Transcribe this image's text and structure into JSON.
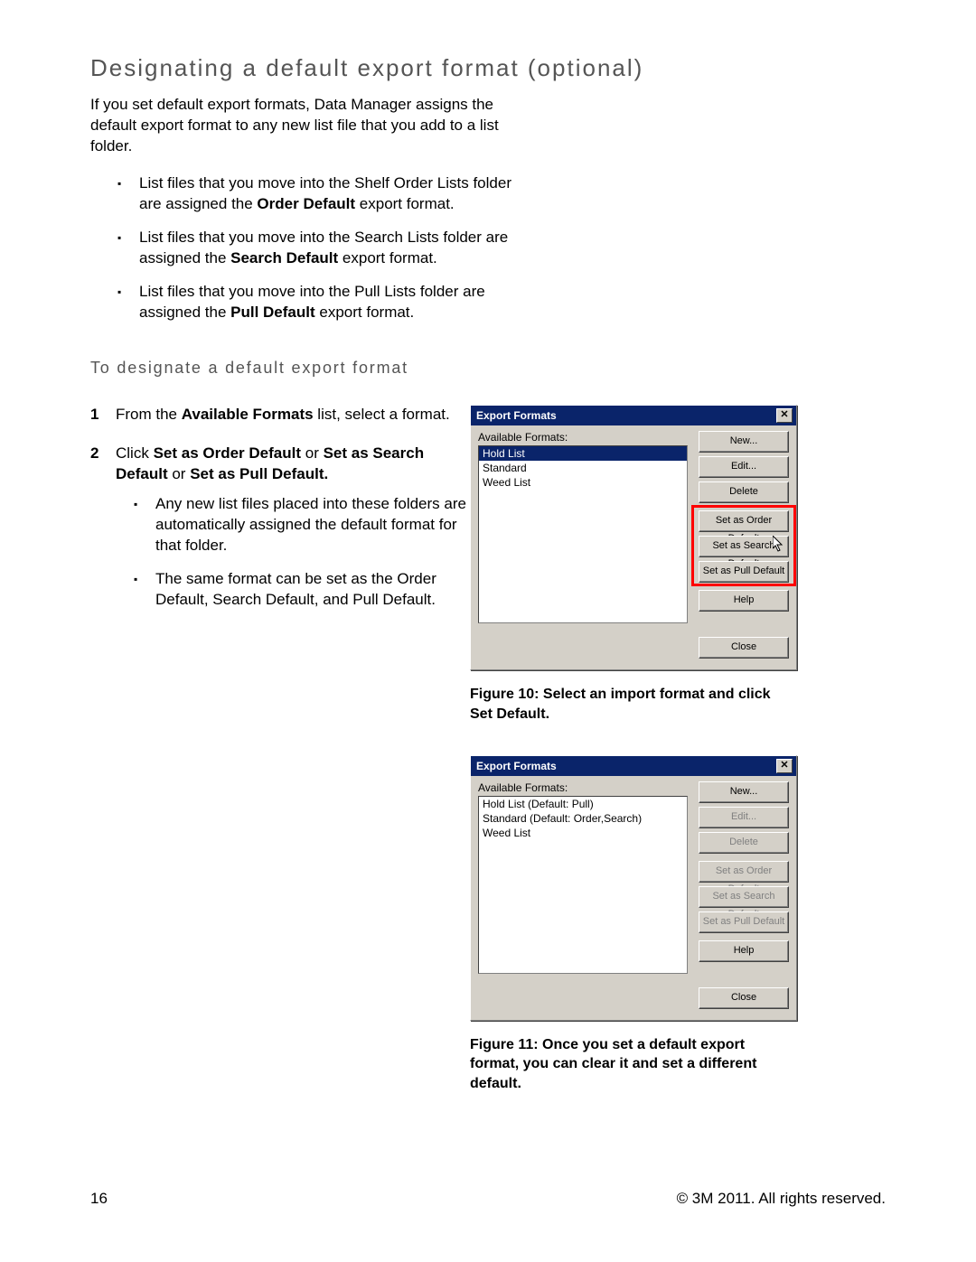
{
  "heading": "Designating a default export format (optional)",
  "intro": "If you set default export formats, Data Manager assigns the default export format to any new list file that you add to a list folder.",
  "bullets": [
    {
      "pre": "List files that you move into the Shelf Order Lists folder are assigned the ",
      "bold": "Order Default",
      "post": " export format."
    },
    {
      "pre": "List files that you move into the Search Lists folder are assigned the ",
      "bold": "Search Default",
      "post": " export format."
    },
    {
      "pre": "List files that you move into the Pull Lists folder are assigned the ",
      "bold": "Pull Default",
      "post": " export format."
    }
  ],
  "subheading": "To designate a default export format",
  "step1": {
    "pre": "From the ",
    "bold": "Available Formats",
    "post": " list, select a format."
  },
  "step2": {
    "pre": "Click ",
    "b1": "Set as Order Default",
    "mid1": " or ",
    "b2": "Set as Search Default",
    "mid2": " or ",
    "b3": "Set as Pull Default.",
    "sub": [
      "Any new list files placed into these folders are automatically assigned the default format for that folder.",
      "The same format can be set as the Order Default, Search Default, and Pull Default."
    ]
  },
  "dialog": {
    "title": "Export Formats",
    "available_label": "Available Formats:",
    "buttons": {
      "new": "New...",
      "edit": "Edit...",
      "delete": "Delete",
      "order": "Set as Order Default",
      "search": "Set as Search Default",
      "pull": "Set as Pull Default",
      "help": "Help",
      "close": "Close"
    }
  },
  "dialog1_items": [
    "Hold List",
    "Standard",
    "Weed List"
  ],
  "dialog2_items": [
    "Hold List (Default: Pull)",
    "Standard (Default: Order,Search)",
    "Weed List"
  ],
  "caption1": "Figure 10: Select an import format and click Set Default.",
  "caption2": "Figure 11: Once you set a default export format, you can clear it and set a different default.",
  "footer": {
    "page": "16",
    "copyright": "© 3M 2011. All rights reserved."
  }
}
